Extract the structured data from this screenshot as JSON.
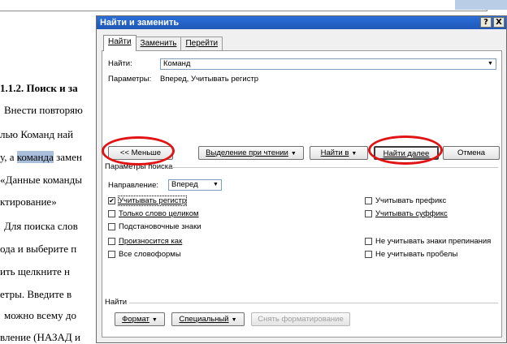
{
  "document": {
    "lines": [
      "1.1.2. Поиск и за",
      "Внести повторяю",
      "лью Команд най",
      "у, а команда замен",
      "«Данные команды",
      "ктирование»",
      "Для поиска слов",
      "ода и выберите п",
      "ить щелкните н",
      "етры. Введите в",
      "можно всему до",
      "вление (НАЗАД и"
    ],
    "highlight_word": "команда"
  },
  "dialog": {
    "title": "Найти и заменить",
    "title_buttons": [
      "?",
      "X"
    ],
    "tabs": [
      "Найти",
      "Заменить",
      "Перейти"
    ],
    "find_label": "Найти:",
    "find_value": "Команд",
    "params_label": "Параметры:",
    "params_value": "Вперед, Учитывать регистр",
    "buttons": {
      "less": "<< Меньше",
      "reading_highlight": "Выделение при чтении",
      "find_in": "Найти в",
      "find_next": "Найти далее",
      "cancel": "Отмена"
    },
    "search_options_label": "Параметры поиска",
    "direction_label": "Направление:",
    "direction_value": "Вперед",
    "checkboxes_left": [
      {
        "label": "Учитывать регистр",
        "checked": true
      },
      {
        "label": "Только слово целиком",
        "checked": false
      },
      {
        "label": "Подстановочные знаки",
        "checked": false
      },
      {
        "label": "Произносится как",
        "checked": false
      },
      {
        "label": "Все словоформы",
        "checked": false
      }
    ],
    "checkboxes_right": [
      {
        "label": "Учитывать префикс",
        "checked": false
      },
      {
        "label": "Учитывать суффикс",
        "checked": false
      },
      {
        "label": "Не учитывать знаки препинания",
        "checked": false
      },
      {
        "label": "Не учитывать пробелы",
        "checked": false
      }
    ],
    "find_section_label": "Найти",
    "bottom_buttons": {
      "format": "Формат",
      "special": "Специальный",
      "clear_formatting": "Снять форматирование"
    }
  },
  "colors": {
    "title_bar": "#1f58b8",
    "annotation_ring": "#e01414",
    "highlight": "#a9bedb"
  }
}
